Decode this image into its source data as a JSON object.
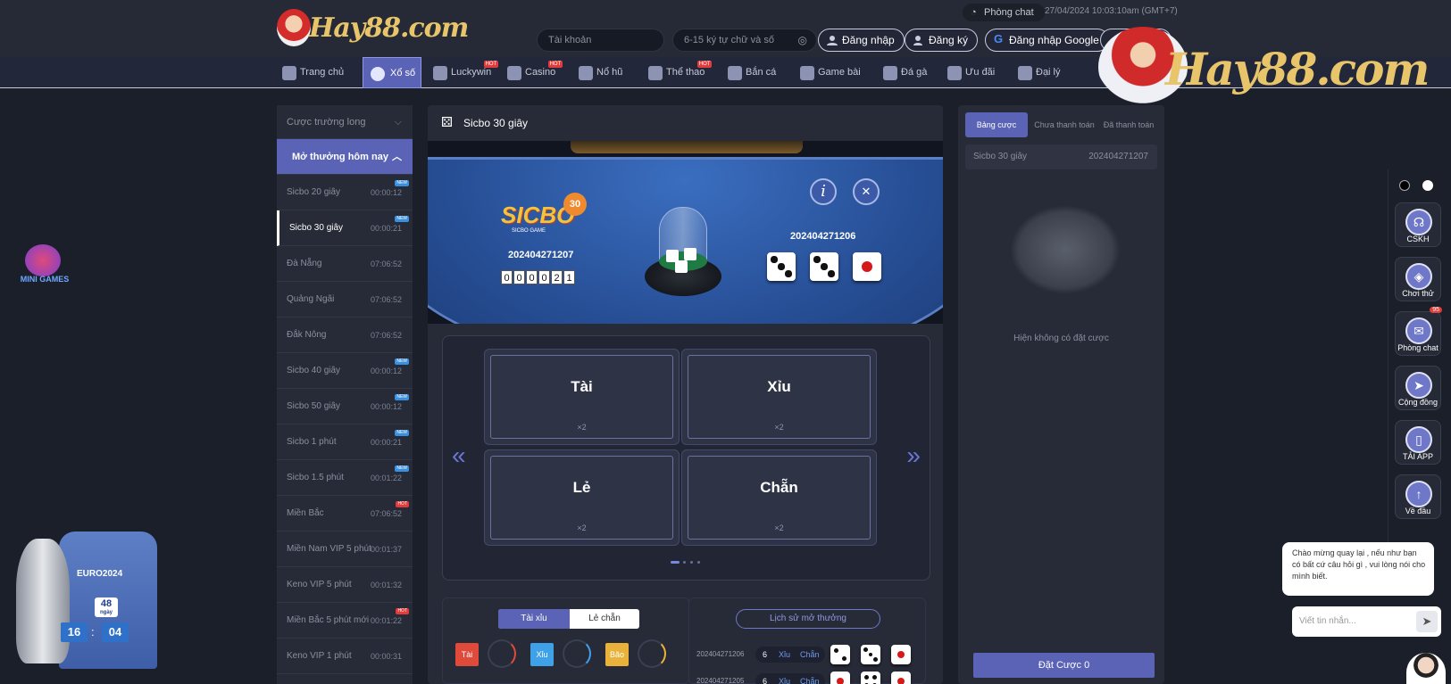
{
  "header": {
    "brand": "Hay88.com",
    "account_placeholder": "Tài khoản",
    "password_placeholder": "6-15 ký tự chữ và số",
    "login": "Đăng nhập",
    "register": "Đăng ký",
    "google_login": "Đăng nhập Google",
    "chat_room": "Phòng chat",
    "datetime": "27/04/2024 10:03:10am",
    "timezone": "(GMT+7)"
  },
  "nav": [
    {
      "label": "Trang chủ",
      "hot": false
    },
    {
      "label": "Xổ số",
      "hot": false,
      "active": true
    },
    {
      "label": "Luckywin",
      "hot": true
    },
    {
      "label": "Casino",
      "hot": true
    },
    {
      "label": "Nổ hũ",
      "hot": false
    },
    {
      "label": "Thể thao",
      "hot": true
    },
    {
      "label": "Bắn cá",
      "hot": false
    },
    {
      "label": "Game bài",
      "hot": false
    },
    {
      "label": "Đá gà",
      "hot": false
    },
    {
      "label": "Ưu đãi",
      "hot": false
    },
    {
      "label": "Đại lý",
      "hot": false
    }
  ],
  "hot_label": "HOT",
  "new_label": "NEW",
  "sidebar": {
    "section1": "Cược trường long",
    "section2": "Mở thưởng hôm nay",
    "items": [
      {
        "name": "Sicbo 20 giây",
        "time": "00:00:12",
        "badge": "NEW"
      },
      {
        "name": "Sicbo 30 giây",
        "time": "00:00:21",
        "badge": "NEW",
        "active": true
      },
      {
        "name": "Đà Nẵng",
        "time": "07:06:52",
        "badge": ""
      },
      {
        "name": "Quảng Ngãi",
        "time": "07:06:52",
        "badge": ""
      },
      {
        "name": "Đắk Nông",
        "time": "07:06:52",
        "badge": ""
      },
      {
        "name": "Sicbo 40 giây",
        "time": "00:00:12",
        "badge": "NEW"
      },
      {
        "name": "Sicbo 50 giây",
        "time": "00:00:12",
        "badge": "NEW"
      },
      {
        "name": "Sicbo 1 phút",
        "time": "00:00:21",
        "badge": "NEW"
      },
      {
        "name": "Sicbo 1.5 phút",
        "time": "00:01:22",
        "badge": "NEW"
      },
      {
        "name": "Miền Bắc",
        "time": "07:06:52",
        "badge": "HOT"
      },
      {
        "name": "Miền Nam VIP 5 phút",
        "time": "00:01:37",
        "badge": ""
      },
      {
        "name": "Keno VIP 5 phút",
        "time": "00:01:32",
        "badge": ""
      },
      {
        "name": "Miền Bắc 5 phút mới",
        "time": "00:01:22",
        "badge": "HOT"
      },
      {
        "name": "Keno VIP 1 phút",
        "time": "00:00:31",
        "badge": ""
      }
    ]
  },
  "game": {
    "title": "Sicbo 30 giây",
    "logo_text": "SICBO",
    "logo_num": "30",
    "logo_sub": "SICBO GAME",
    "current_period": "202404271207",
    "countdown": [
      "0",
      "0",
      "0",
      "0",
      "2",
      "1"
    ],
    "last_period": "202404271206",
    "last_dice": [
      3,
      3,
      1
    ],
    "bets": [
      {
        "label": "Tài",
        "odds": "×2"
      },
      {
        "label": "Xỉu",
        "odds": "×2"
      },
      {
        "label": "Lẻ",
        "odds": "×2"
      },
      {
        "label": "Chẵn",
        "odds": "×2"
      }
    ],
    "tabs": [
      "Tài xỉu",
      "Lẻ chẵn"
    ],
    "stats": [
      {
        "label": "Tài",
        "value": "",
        "color": "#e04a3a"
      },
      {
        "label": "Xỉu",
        "value": "",
        "color": "#3fa1e8"
      },
      {
        "label": "Bão",
        "value": "",
        "color": "#e9b23a"
      }
    ],
    "history_button": "Lịch sử mở thưởng",
    "history": [
      {
        "period": "202404271206",
        "sum": "6",
        "size": "Xỉu",
        "parity": "Chẵn",
        "dice": [
          2,
          3,
          1
        ]
      },
      {
        "period": "202404271205",
        "sum": "6",
        "size": "Xỉu",
        "parity": "Chẵn",
        "dice": [
          1,
          4,
          1
        ]
      }
    ]
  },
  "right": {
    "tabs": [
      "Bảng cược",
      "Chưa thanh toán",
      "Đã thanh toán"
    ],
    "game": "Sicbo 30 giây",
    "period": "202404271207",
    "empty": "Hiện không có đặt cược",
    "place_bet": "Đặt Cược 0"
  },
  "float": [
    {
      "label": "CSKH",
      "icon": "headset-icon"
    },
    {
      "label": "Chơi thử",
      "icon": "gamepad-icon"
    },
    {
      "label": "Phòng chat",
      "icon": "chat-icon",
      "badge": "95"
    },
    {
      "label": "Cộng đồng",
      "icon": "send-icon"
    },
    {
      "label": "TẢI APP",
      "icon": "phone-icon"
    },
    {
      "label": "Về đầu",
      "icon": "arrow-up-icon"
    }
  ],
  "chat": {
    "message": "Chào mừng quay lại , nếu như bạn có bất cứ câu hỏi gì , vui lòng nói cho mình biết.",
    "placeholder": "Viết tin nhắn..."
  },
  "promo": {
    "mini_games": "MINI GAMES",
    "euro": "EURO2024",
    "days": "48",
    "days_label": "ngày",
    "hours": "16",
    "minutes": "04"
  }
}
